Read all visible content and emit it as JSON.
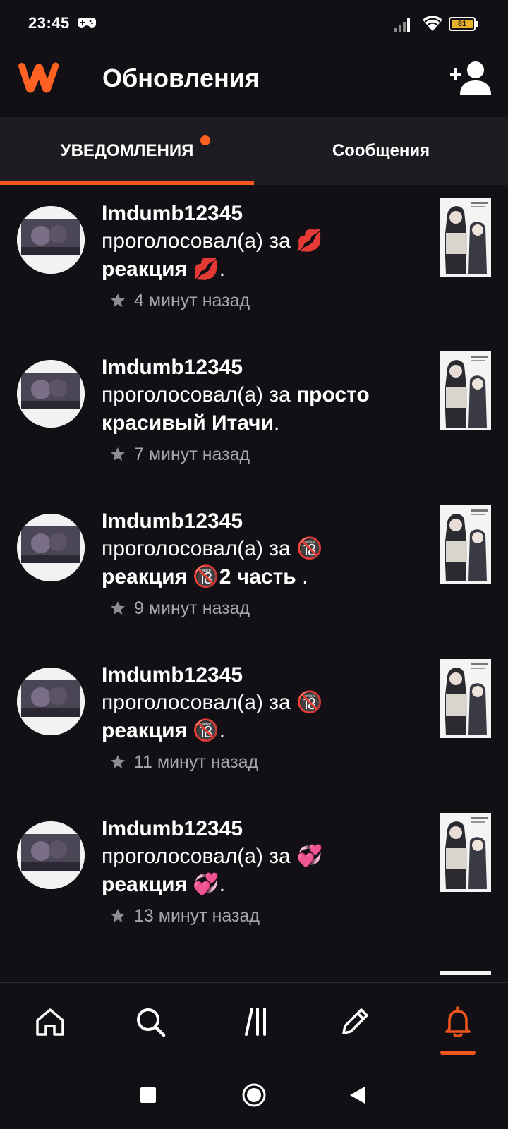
{
  "status_bar": {
    "time": "23:45",
    "battery_level": "81",
    "icons": [
      "gamepad-icon",
      "signal-icon",
      "wifi-icon",
      "battery-icon"
    ]
  },
  "header": {
    "logo": "wattpad-logo-icon",
    "title": "Обновления",
    "action_icon": "add-user-icon"
  },
  "tabs": [
    {
      "label": "УВЕДОМЛЕНИЯ",
      "active": true,
      "has_dot": true
    },
    {
      "label": "Сообщения",
      "active": false,
      "has_dot": false
    }
  ],
  "notifications": [
    {
      "username": "Imdumb12345",
      "verb": "проголосовал(а) за ",
      "title_line1_emoji": "💋",
      "title": "реакция 💋",
      "suffix": ".",
      "time": "4 минут назад"
    },
    {
      "username": "Imdumb12345",
      "verb": "проголосовал(а) за ",
      "title_line1_emoji": "",
      "title": "просто красивый Итачи",
      "suffix": ".",
      "time": "7 минут назад"
    },
    {
      "username": "Imdumb12345",
      "verb": "проголосовал(а) за ",
      "title_line1_emoji": "🔞",
      "title": "реакция 🔞2 часть ",
      "suffix": ".",
      "time": "9 минут назад"
    },
    {
      "username": "Imdumb12345",
      "verb": "проголосовал(а) за ",
      "title_line1_emoji": "🔞",
      "title": "реакция 🔞",
      "suffix": ".",
      "time": "11 минут назад"
    },
    {
      "username": "Imdumb12345",
      "verb": "проголосовал(а) за ",
      "title_line1_emoji": "💞",
      "title": "реакция 💞",
      "suffix": ".",
      "time": "13 минут назад"
    }
  ],
  "bottom_nav": [
    {
      "icon": "home-icon",
      "active": false
    },
    {
      "icon": "search-icon",
      "active": false
    },
    {
      "icon": "library-icon",
      "active": false
    },
    {
      "icon": "pencil-icon",
      "active": false
    },
    {
      "icon": "bell-icon",
      "active": true
    }
  ],
  "system_nav": [
    "recents-square-icon",
    "home-circle-icon",
    "back-triangle-icon"
  ],
  "colors": {
    "accent": "#f1571d",
    "background": "#121015",
    "tab_background": "#1d1c20",
    "muted_text": "#a8a6ab"
  }
}
